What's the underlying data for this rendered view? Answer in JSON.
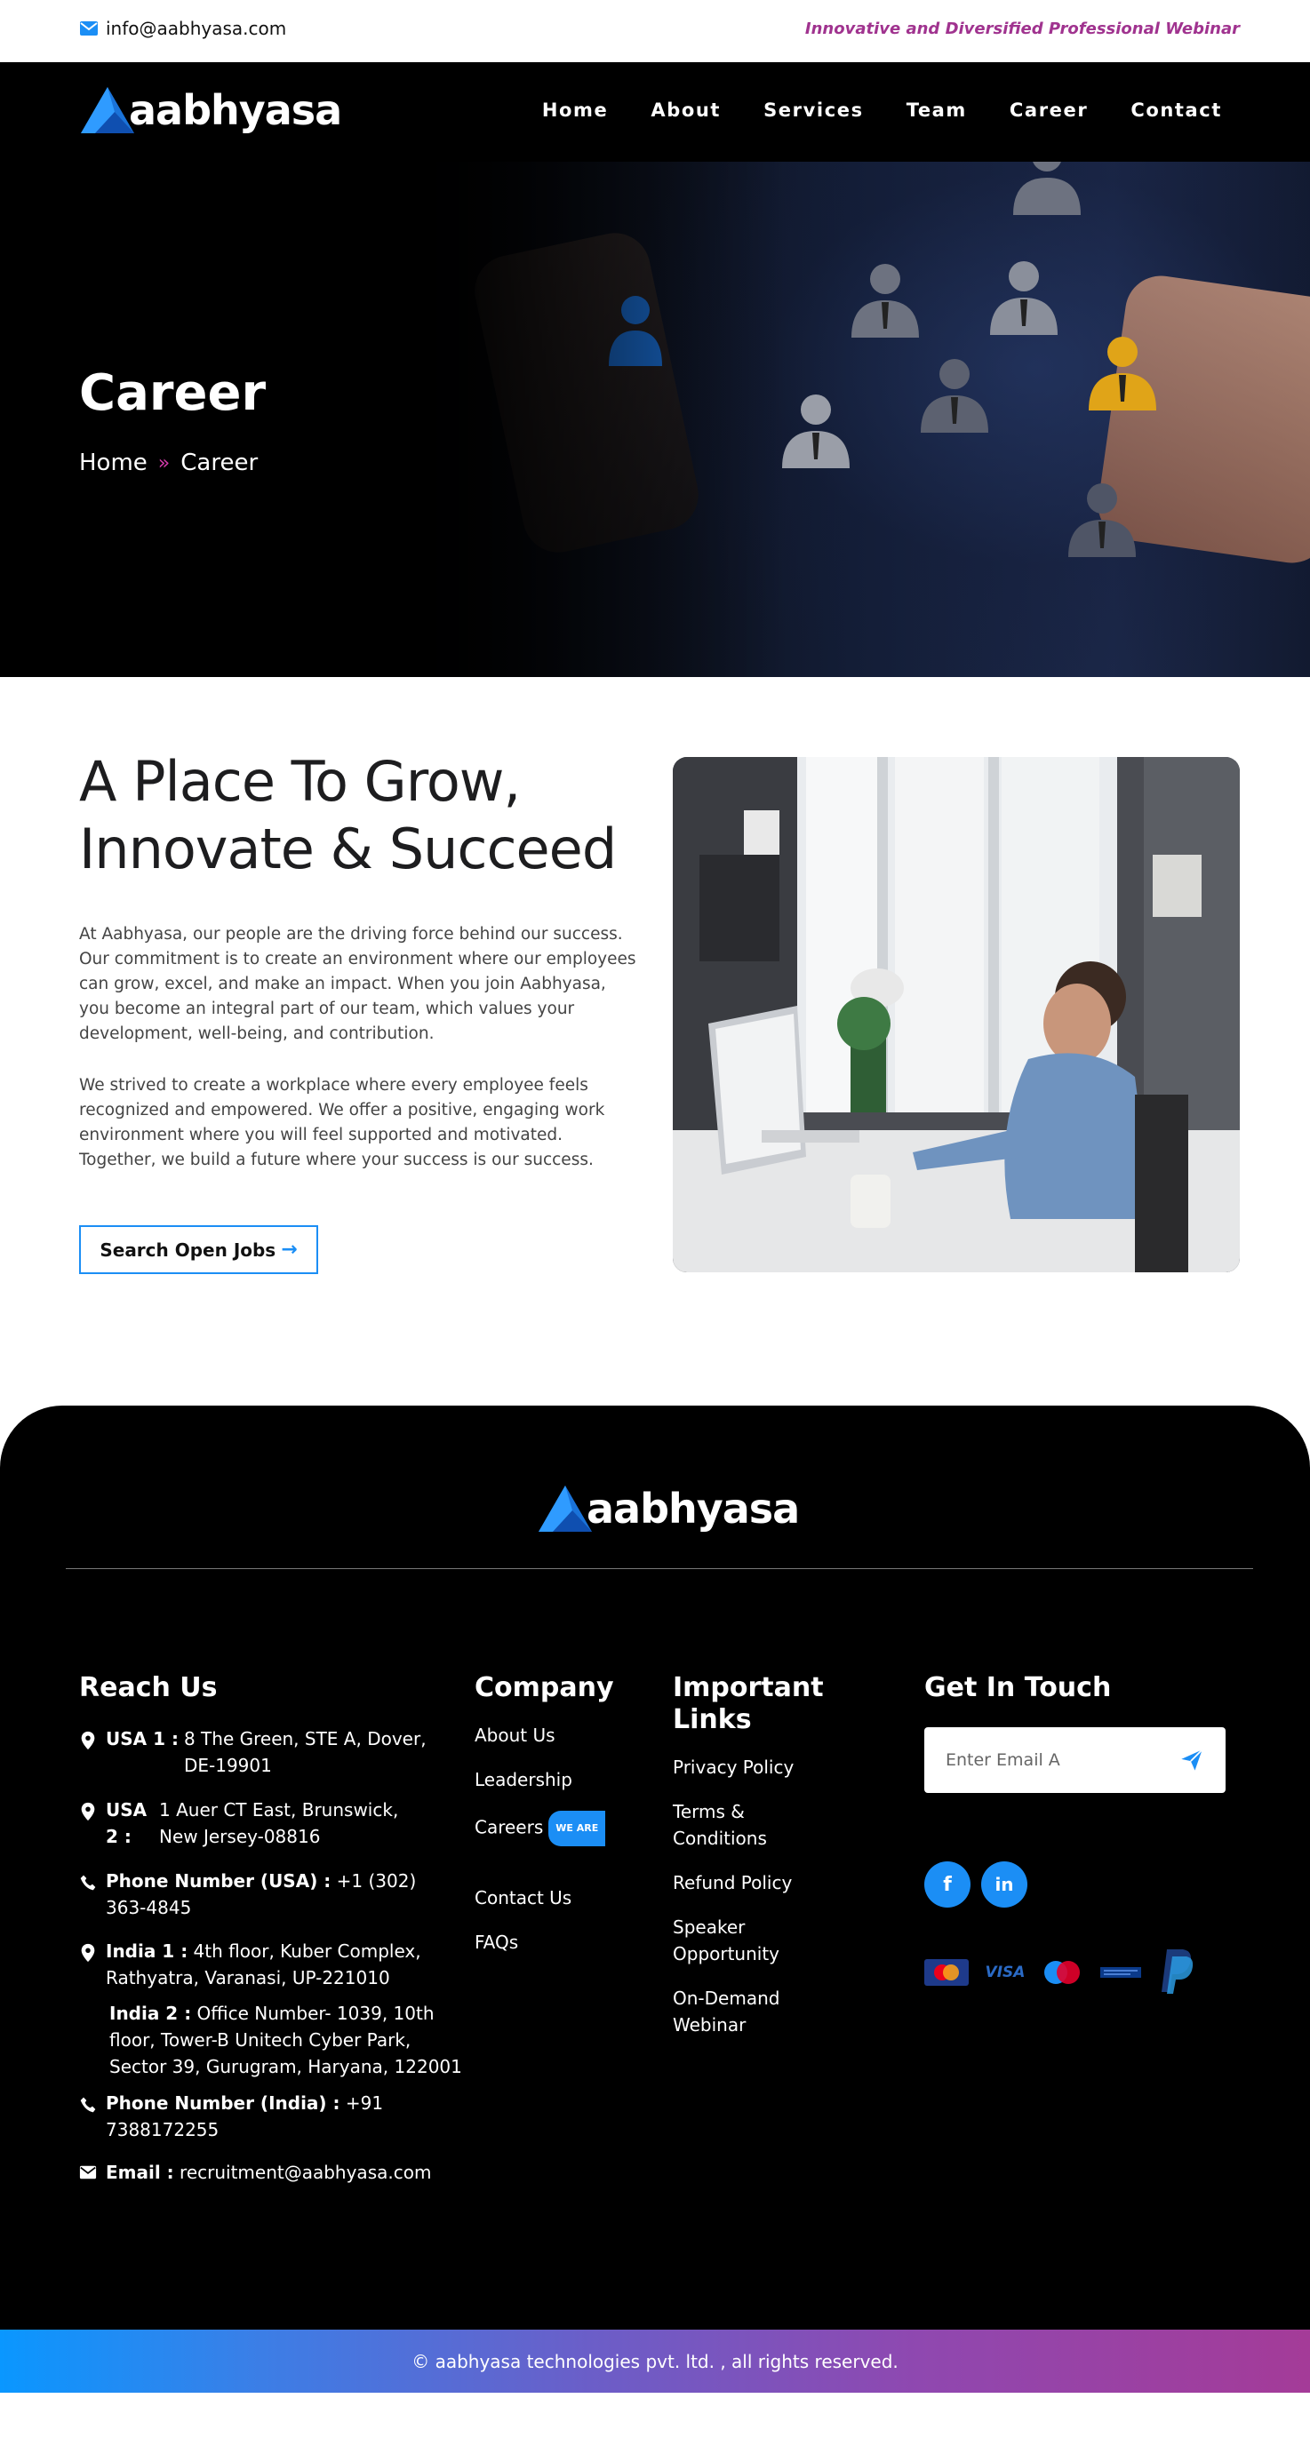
{
  "topbar": {
    "email": "info@aabhyasa.com",
    "tagline": "Innovative and Diversified Professional Webinar"
  },
  "brand": {
    "name": "aabhyasa",
    "accent_color": "#1b8ef5",
    "tagline_color": "#a0338f"
  },
  "nav": {
    "items": [
      "Home",
      "About",
      "Services",
      "Team",
      "Career",
      "Contact"
    ]
  },
  "hero": {
    "title": "Career",
    "breadcrumb_home": "Home",
    "breadcrumb_sep": "»",
    "breadcrumb_current": "Career"
  },
  "intro": {
    "heading": "A Place To Grow, Innovate & Succeed",
    "paragraph1": "At Aabhyasa, our people are the driving force behind our success. Our commitment is to create an environment where our employees can grow, excel, and make an impact. When you join Aabhyasa, you become an integral part of our team, which values your development, well-being, and contribution.",
    "paragraph2": "We strived to create a workplace where every employee feels recognized and empowered. We offer a positive, engaging work environment where you will feel supported and motivated. Together, we build a future where your success is our success.",
    "button_label": "Search Open Jobs",
    "button_icon": "arrow-right-icon"
  },
  "footer": {
    "reach_title": "Reach Us",
    "reach": [
      {
        "label": "USA 1 :",
        "value": "8 The Green, STE A, Dover, DE-19901",
        "icon": "map-pin-icon"
      },
      {
        "label": "USA 2 :",
        "value": "1 Auer CT East, Brunswick, New Jersey-08816",
        "icon": "map-pin-icon"
      },
      {
        "label": "Phone Number (USA) :",
        "value": "+1 (302) 363-4845",
        "icon": "phone-icon"
      },
      {
        "label": "India 1 :",
        "value": "4th floor, Kuber Complex, Rathyatra, Varanasi, UP-221010",
        "icon": "map-pin-icon"
      },
      {
        "label": "India 2 :",
        "value": "Office Number- 1039, 10th floor, Tower-B Unitech Cyber Park, Sector 39, Gurugram, Haryana, 122001",
        "icon": ""
      },
      {
        "label": "Phone Number (India) :",
        "value": "+91 7388172255",
        "icon": "phone-icon"
      },
      {
        "label": "Email :",
        "value": "recruitment@aabhyasa.com",
        "icon": "envelope-icon"
      }
    ],
    "company_title": "Company",
    "company_links": [
      "About Us",
      "Leadership",
      "Careers",
      "Contact Us",
      "FAQs"
    ],
    "careers_badge": "WE ARE",
    "important_title": "Important Links",
    "important_links": [
      "Privacy Policy",
      "Terms & Conditions",
      "Refund Policy",
      "Speaker Opportunity",
      "On-Demand Webinar"
    ],
    "touch_title": "Get In Touch",
    "email_placeholder": "Enter Email A",
    "social": [
      "facebook-icon",
      "linkedin-icon"
    ],
    "payments": [
      "mastercard-icon",
      "visa-icon",
      "maestro-icon",
      "american-express-icon",
      "paypal-icon"
    ],
    "payment_labels": {
      "visa": "VISA"
    },
    "copyright": "© aabhyasa technologies pvt. ltd. , all rights reserved."
  }
}
